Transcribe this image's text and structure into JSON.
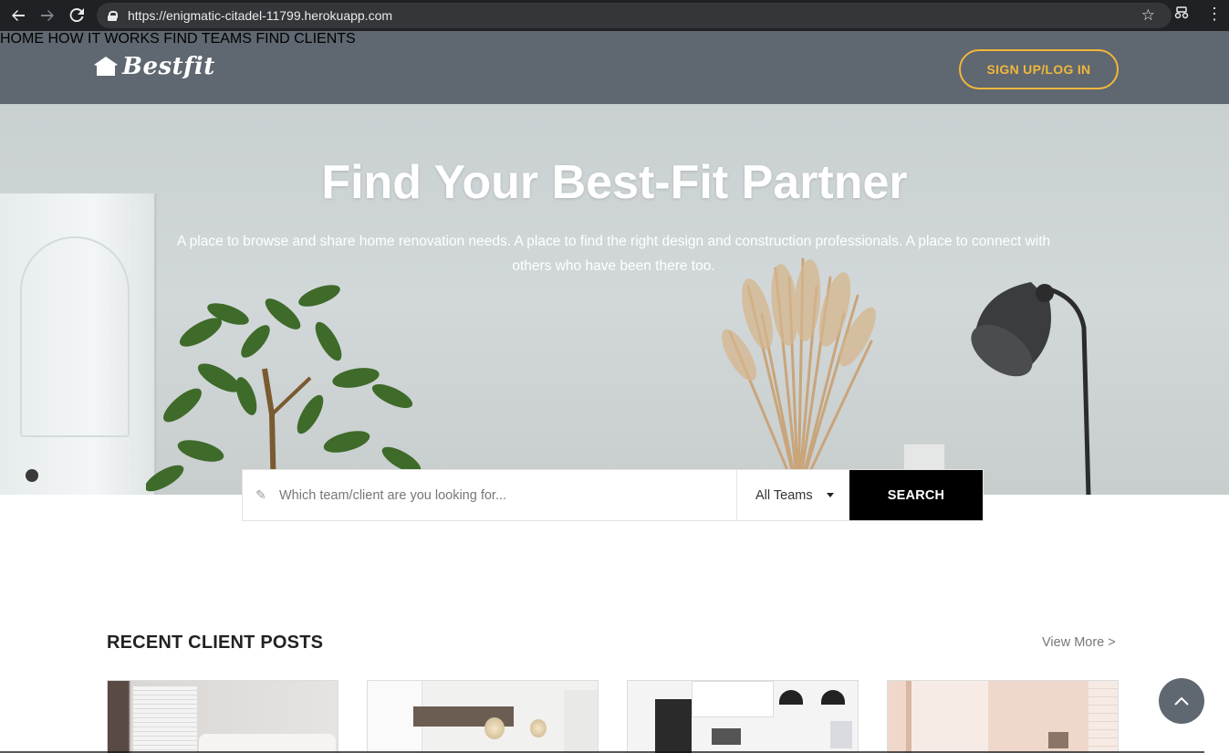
{
  "browser": {
    "url": "https://enigmatic-citadel-11799.herokuapp.com",
    "icons": [
      "back-icon",
      "forward-icon",
      "reload-icon",
      "lock-icon",
      "bookmark-star-icon",
      "extension-icon",
      "menu-icon"
    ]
  },
  "header": {
    "logo_text": "Bestfit",
    "nav": [
      "HOME",
      "HOW IT WORKS",
      "FIND TEAMS",
      "FIND CLIENTS"
    ],
    "signup_label": "SIGN UP/LOG IN",
    "accent_color": "#f0b73b",
    "background_color": "#5f6770"
  },
  "hero": {
    "title": "Find Your Best-Fit Partner",
    "subtitle": "A place to browse and share home renovation needs. A place to find the right design and construction professionals. A place to connect with others who have been there too."
  },
  "search": {
    "placeholder": "Which team/client are you looking for...",
    "value": "",
    "category_selected": "All Teams",
    "button_label": "SEARCH"
  },
  "recent_posts": {
    "title": "RECENT CLIENT POSTS",
    "view_more": "View More >"
  }
}
